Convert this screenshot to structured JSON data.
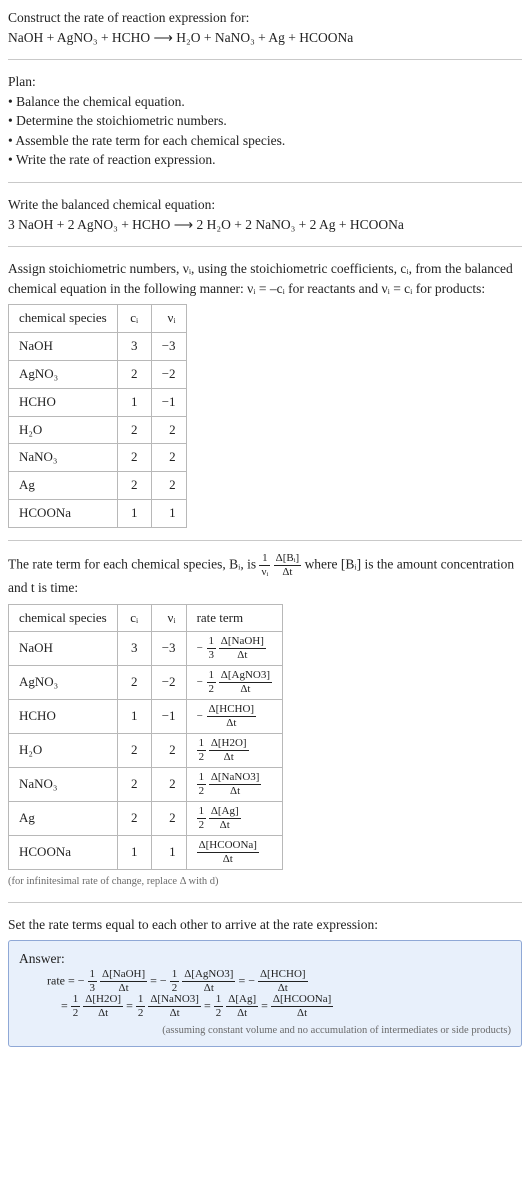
{
  "prompt": "Construct the rate of reaction expression for:",
  "equation_unbalanced": "NaOH + AgNO₃ + HCHO  ⟶  H₂O + NaNO₃ + Ag + HCOONa",
  "plan_header": "Plan:",
  "plan_items": [
    "Balance the chemical equation.",
    "Determine the stoichiometric numbers.",
    "Assemble the rate term for each chemical species.",
    "Write the rate of reaction expression."
  ],
  "balanced_header": "Write the balanced chemical equation:",
  "equation_balanced": "3 NaOH + 2 AgNO₃ + HCHO  ⟶  2 H₂O + 2 NaNO₃ + 2 Ag + HCOONa",
  "assign_text_1": "Assign stoichiometric numbers, νᵢ, using the stoichiometric coefficients, cᵢ, from the balanced chemical equation in the following manner: νᵢ = –cᵢ for reactants and νᵢ = cᵢ for products:",
  "table1": {
    "headers": [
      "chemical species",
      "cᵢ",
      "νᵢ"
    ],
    "rows": [
      [
        "NaOH",
        "3",
        "−3"
      ],
      [
        "AgNO₃",
        "2",
        "−2"
      ],
      [
        "HCHO",
        "1",
        "−1"
      ],
      [
        "H₂O",
        "2",
        "2"
      ],
      [
        "NaNO₃",
        "2",
        "2"
      ],
      [
        "Ag",
        "2",
        "2"
      ],
      [
        "HCOONa",
        "1",
        "1"
      ]
    ]
  },
  "rate_term_text_1": "The rate term for each chemical species, Bᵢ, is ",
  "rate_term_formula": {
    "coef_num": "1",
    "coef_den": "νᵢ",
    "delta_num": "Δ[Bᵢ]",
    "delta_den": "Δt"
  },
  "rate_term_text_2": " where [Bᵢ] is the amount concentration and t is time:",
  "table2": {
    "headers": [
      "chemical species",
      "cᵢ",
      "νᵢ",
      "rate term"
    ],
    "rows": [
      {
        "sp": "NaOH",
        "c": "3",
        "v": "−3",
        "neg": "−",
        "cnum": "1",
        "cden": "3",
        "dnum": "Δ[NaOH]",
        "dden": "Δt"
      },
      {
        "sp": "AgNO₃",
        "c": "2",
        "v": "−2",
        "neg": "−",
        "cnum": "1",
        "cden": "2",
        "dnum": "Δ[AgNO3]",
        "dden": "Δt"
      },
      {
        "sp": "HCHO",
        "c": "1",
        "v": "−1",
        "neg": "−",
        "cnum": "",
        "cden": "",
        "dnum": "Δ[HCHO]",
        "dden": "Δt"
      },
      {
        "sp": "H₂O",
        "c": "2",
        "v": "2",
        "neg": "",
        "cnum": "1",
        "cden": "2",
        "dnum": "Δ[H2O]",
        "dden": "Δt"
      },
      {
        "sp": "NaNO₃",
        "c": "2",
        "v": "2",
        "neg": "",
        "cnum": "1",
        "cden": "2",
        "dnum": "Δ[NaNO3]",
        "dden": "Δt"
      },
      {
        "sp": "Ag",
        "c": "2",
        "v": "2",
        "neg": "",
        "cnum": "1",
        "cden": "2",
        "dnum": "Δ[Ag]",
        "dden": "Δt"
      },
      {
        "sp": "HCOONa",
        "c": "1",
        "v": "1",
        "neg": "",
        "cnum": "",
        "cden": "",
        "dnum": "Δ[HCOONa]",
        "dden": "Δt"
      }
    ]
  },
  "infinitesimal_note": "(for infinitesimal rate of change, replace Δ with d)",
  "set_equal_text": "Set the rate terms equal to each other to arrive at the rate expression:",
  "answer_label": "Answer:",
  "answer": {
    "line1_prefix": "rate = ",
    "terms": [
      {
        "neg": "−",
        "cnum": "1",
        "cden": "3",
        "dnum": "Δ[NaOH]",
        "dden": "Δt"
      },
      {
        "neg": "−",
        "cnum": "1",
        "cden": "2",
        "dnum": "Δ[AgNO3]",
        "dden": "Δt"
      },
      {
        "neg": "−",
        "cnum": "",
        "cden": "",
        "dnum": "Δ[HCHO]",
        "dden": "Δt"
      },
      {
        "neg": "",
        "cnum": "1",
        "cden": "2",
        "dnum": "Δ[H2O]",
        "dden": "Δt"
      },
      {
        "neg": "",
        "cnum": "1",
        "cden": "2",
        "dnum": "Δ[NaNO3]",
        "dden": "Δt"
      },
      {
        "neg": "",
        "cnum": "1",
        "cden": "2",
        "dnum": "Δ[Ag]",
        "dden": "Δt"
      },
      {
        "neg": "",
        "cnum": "",
        "cden": "",
        "dnum": "Δ[HCOONa]",
        "dden": "Δt"
      }
    ],
    "assumption": "(assuming constant volume and no accumulation of intermediates or side products)"
  }
}
